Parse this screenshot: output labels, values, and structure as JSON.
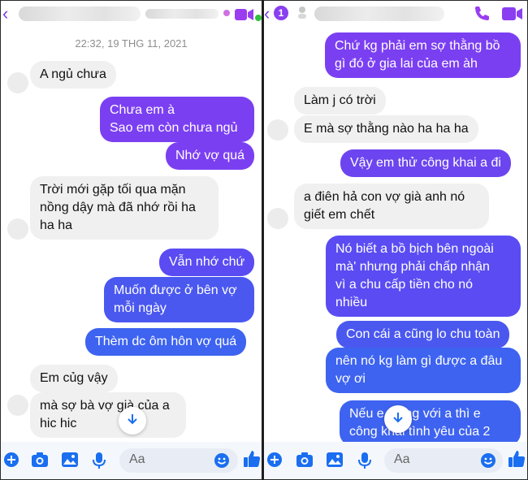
{
  "left": {
    "timestamp": "22:32, 19 THG 11, 2021",
    "messages": [
      {
        "text": "A ngủ chưa"
      },
      {
        "text": "Chưa em à\nSao em còn chưa ngủ"
      },
      {
        "text": "Nhớ vợ quá"
      },
      {
        "text": "Trời mới gặp tối qua mặn\nnồng dậy mà đã nhớ rồi ha\nha ha"
      },
      {
        "text": "Vẫn nhớ chứ"
      },
      {
        "text": "Muốn được ở bên vợ\nmỗi ngày"
      },
      {
        "text": "Thèm dc ôm hôn vợ quá"
      },
      {
        "text": "Em củg vậy"
      },
      {
        "text": "mà sợ bà vợ già của a\nhic hic"
      }
    ],
    "composer_placeholder": "Aa"
  },
  "right": {
    "badge": "1",
    "messages": [
      {
        "text": "Chứ kg phải em sợ thằng bồ\ngì đó ở gia lai của em àh"
      },
      {
        "text": "Làm j có trời"
      },
      {
        "text": "E mà sợ thằng nào ha ha ha"
      },
      {
        "text": "Vậy em thử công khai a đi"
      },
      {
        "text": "a điên hả con vợ già anh nó\ngiết em chết"
      },
      {
        "text": "Nó biết a bồ bịch bên ngoài\nmà' nhưng phải chấp nhận\nvì a chu cấp tiền cho nó\nnhiều"
      },
      {
        "text": "Con cái a cũng lo chu toàn"
      },
      {
        "text": "nên nó kg làm gì được a đâu\nvợ ơi"
      },
      {
        "text": "Nếu e     t lòng với a thì e\ncông khai tình yêu của 2"
      }
    ],
    "composer_placeholder": "Aa"
  },
  "colors": {
    "accent_purple": "#7b3ff2",
    "accent_blue": "#3d63f0",
    "incoming_bg": "#f0f0f0",
    "icon_blue": "#1a6ef0"
  },
  "icons": {
    "header": [
      "back-chevron-icon",
      "phone-icon",
      "video-icon"
    ],
    "composer": [
      "plus-icon",
      "camera-icon",
      "image-icon",
      "microphone-icon",
      "emoji-icon",
      "thumbs-up-icon"
    ],
    "scroll": "arrow-down-icon"
  }
}
